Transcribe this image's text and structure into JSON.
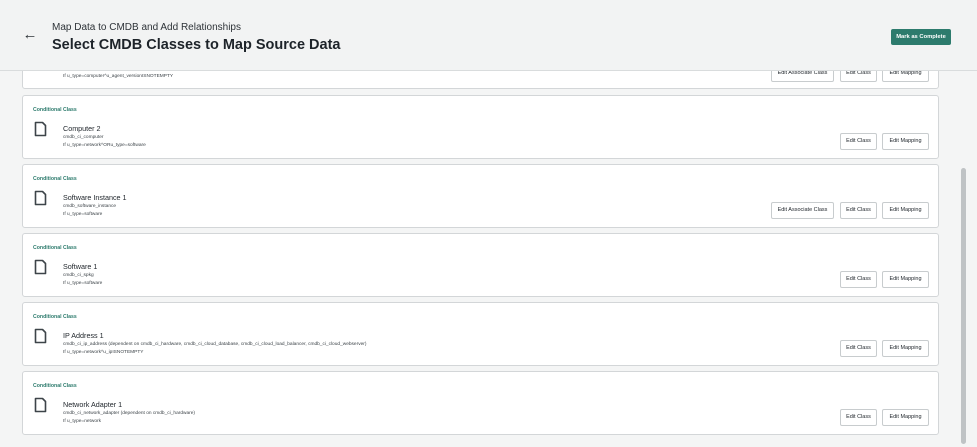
{
  "header": {
    "subtitle": "Map Data to CMDB and Add Relationships",
    "title": "Select CMDB Classes to Map Source Data",
    "complete_label": "Mark as Complete"
  },
  "partial_card": {
    "condition": "If u_type=computer^u_agent_versionISNOTEMPTY",
    "buttons": {
      "associate": "Edit Associate Class",
      "class": "Edit Class",
      "mapping": "Edit Mapping"
    }
  },
  "cards": [
    {
      "label": "Conditional Class",
      "name": "Computer 2",
      "table": "cmdb_ci_computer",
      "condition": "If u_type=network^ORu_type=software",
      "buttons": {
        "class": "Edit Class",
        "mapping": "Edit Mapping"
      }
    },
    {
      "label": "Conditional Class",
      "name": "Software Instance 1",
      "table": "cmdb_software_instance",
      "condition": "If u_type=software",
      "buttons": {
        "associate": "Edit Associate Class",
        "class": "Edit Class",
        "mapping": "Edit Mapping"
      }
    },
    {
      "label": "Conditional Class",
      "name": "Software 1",
      "table": "cmdb_ci_spkg",
      "condition": "If u_type=software",
      "buttons": {
        "class": "Edit Class",
        "mapping": "Edit Mapping"
      }
    },
    {
      "label": "Conditional Class",
      "name": "IP Address 1",
      "table": "cmdb_ci_ip_address (dependent on cmdb_ci_hardware, cmdb_ci_cloud_database, cmdb_ci_cloud_load_balancer, cmdb_ci_cloud_webserver)",
      "condition": "If u_type=network^u_ipISNOTEMPTY",
      "buttons": {
        "class": "Edit Class",
        "mapping": "Edit Mapping"
      }
    },
    {
      "label": "Conditional Class",
      "name": "Network Adapter 1",
      "table": "cmdb_ci_network_adapter (dependent on cmdb_ci_hardware)",
      "condition": "If u_type=network",
      "buttons": {
        "class": "Edit Class",
        "mapping": "Edit Mapping"
      }
    }
  ],
  "icons": {
    "back": "arrow-left-icon",
    "class": "document-icon"
  },
  "colors": {
    "accent": "#2d7b6d",
    "header_bg": "#f2f3f3",
    "page_bg": "#f4f5f5"
  }
}
